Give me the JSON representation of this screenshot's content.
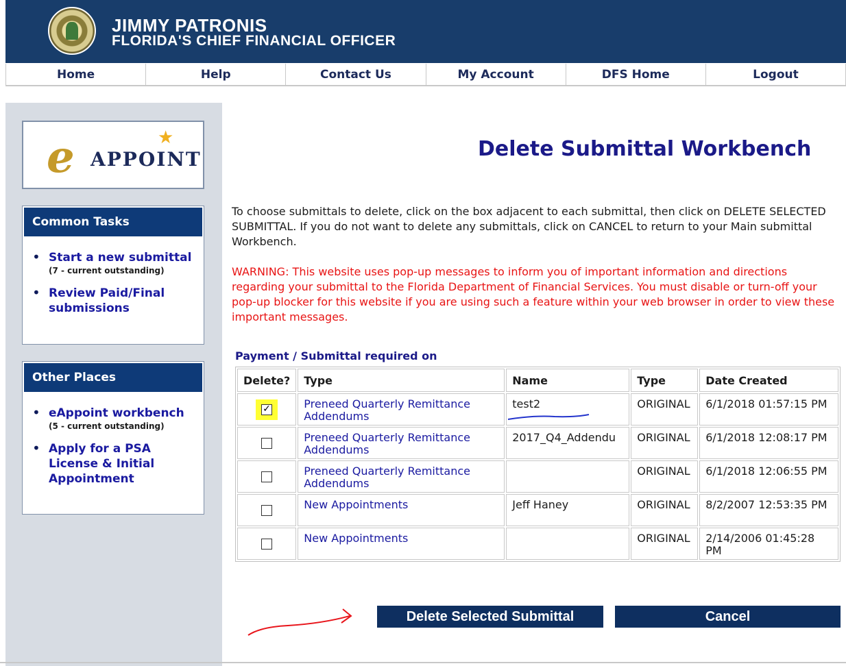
{
  "header": {
    "name": "JIMMY PATRONIS",
    "title": "FLORIDA'S CHIEF FINANCIAL OFFICER"
  },
  "nav": {
    "items": [
      "Home",
      "Help",
      "Contact Us",
      "My Account",
      "DFS Home",
      "Logout"
    ]
  },
  "sidebar": {
    "logo_letter": "e",
    "logo_text": "APPOINT",
    "common_tasks": {
      "title": "Common Tasks",
      "items": [
        {
          "label": "Start a new submittal",
          "sub": "(7 - current outstanding)"
        },
        {
          "label": "Review Paid/Final submissions",
          "sub": ""
        }
      ]
    },
    "other_places": {
      "title": "Other Places",
      "items": [
        {
          "label": "eAppoint workbench",
          "sub": "(5 - current outstanding)"
        },
        {
          "label": "Apply for a PSA License & Initial Appointment",
          "sub": ""
        }
      ]
    }
  },
  "main": {
    "title": "Delete Submittal Workbench",
    "intro": "To choose submittals to delete, click on the box adjacent to each submittal, then click on DELETE SELECTED SUBMITTAL. If you do not want to delete any submittals, click on CANCEL to return to your Main submittal Workbench.",
    "warning": "WARNING: This website uses pop-up messages to inform you of important information and directions regarding your submittal to the Florida Department of Financial Services. You must disable or turn-off your pop-up blocker for this website if you are using such a feature within your web browser in order to view these important messages.",
    "table_caption": "Payment / Submittal required on",
    "columns": [
      "Delete?",
      "Type",
      "Name",
      "Type",
      "Date Created"
    ],
    "rows": [
      {
        "checked": true,
        "type": "Preneed Quarterly Remittance Addendums",
        "name": "test2",
        "kind": "ORIGINAL",
        "date": "6/1/2018 01:57:15 PM"
      },
      {
        "checked": false,
        "type": "Preneed Quarterly Remittance Addendums",
        "name": "2017_Q4_Addendu",
        "kind": "ORIGINAL",
        "date": "6/1/2018 12:08:17 PM"
      },
      {
        "checked": false,
        "type": "Preneed Quarterly Remittance Addendums",
        "name": "",
        "kind": "ORIGINAL",
        "date": "6/1/2018 12:06:55 PM"
      },
      {
        "checked": false,
        "type": "New Appointments",
        "name": "Jeff Haney",
        "kind": "ORIGINAL",
        "date": "8/2/2007 12:53:35 PM"
      },
      {
        "checked": false,
        "type": "New Appointments",
        "name": "",
        "kind": "ORIGINAL",
        "date": "2/14/2006 01:45:28 PM"
      }
    ],
    "delete_button": "Delete Selected Submittal",
    "cancel_button": "Cancel"
  },
  "colors": {
    "header_bg": "#183d6b",
    "accent_blue": "#1b1a88",
    "warning_red": "#e81414",
    "highlight_yellow": "#ffff33"
  }
}
